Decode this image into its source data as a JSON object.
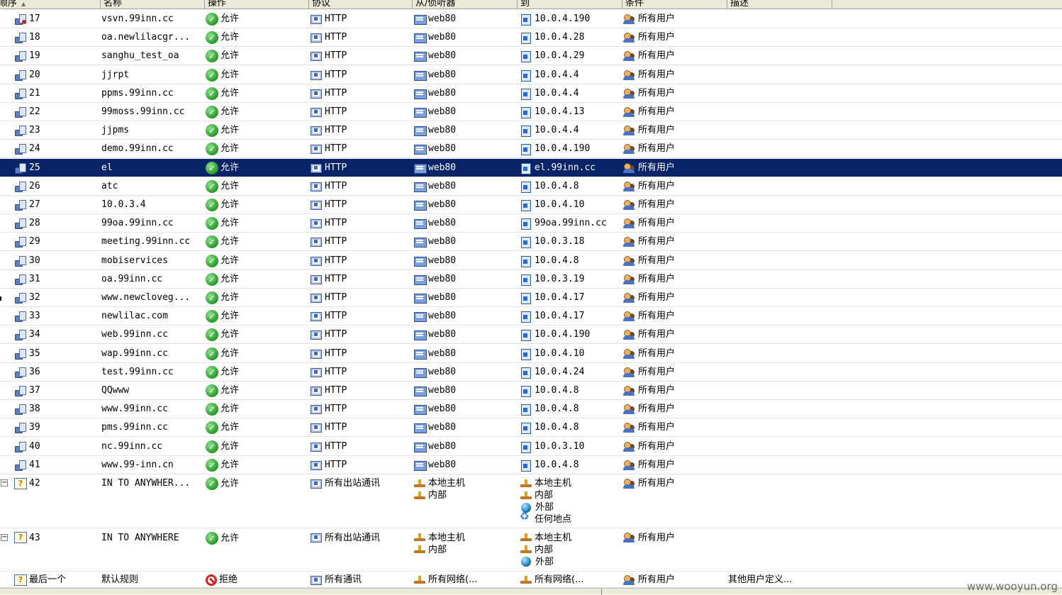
{
  "columns": {
    "order": "顺序",
    "name": "名称",
    "action": "操作",
    "protocol": "协议",
    "from": "从/侦听器",
    "to": "到",
    "condition": "条件",
    "desc": "描述"
  },
  "rules": [
    {
      "order": "17",
      "name": "vsvn.99inn.cc",
      "action": "允许",
      "protocol": "HTTP",
      "from": "web80",
      "to": "10.0.4.190",
      "condition": "所有用户",
      "locked": true
    },
    {
      "order": "18",
      "name": "oa.newlilacgr...",
      "action": "允许",
      "protocol": "HTTP",
      "from": "web80",
      "to": "10.0.4.28",
      "condition": "所有用户"
    },
    {
      "order": "19",
      "name": "sanghu_test_oa",
      "action": "允许",
      "protocol": "HTTP",
      "from": "web80",
      "to": "10.0.4.29",
      "condition": "所有用户"
    },
    {
      "order": "20",
      "name": "jjrpt",
      "action": "允许",
      "protocol": "HTTP",
      "from": "web80",
      "to": "10.0.4.4",
      "condition": "所有用户"
    },
    {
      "order": "21",
      "name": "ppms.99inn.cc",
      "action": "允许",
      "protocol": "HTTP",
      "from": "web80",
      "to": "10.0.4.4",
      "condition": "所有用户"
    },
    {
      "order": "22",
      "name": "99moss.99inn.cc",
      "action": "允许",
      "protocol": "HTTP",
      "from": "web80",
      "to": "10.0.4.13",
      "condition": "所有用户"
    },
    {
      "order": "23",
      "name": "jjpms",
      "action": "允许",
      "protocol": "HTTP",
      "from": "web80",
      "to": "10.0.4.4",
      "condition": "所有用户"
    },
    {
      "order": "24",
      "name": "demo.99inn.cc",
      "action": "允许",
      "protocol": "HTTP",
      "from": "web80",
      "to": "10.0.4.190",
      "condition": "所有用户"
    },
    {
      "order": "25",
      "name": "el",
      "action": "允许",
      "protocol": "HTTP",
      "from": "web80",
      "to": "el.99inn.cc",
      "condition": "所有用户",
      "selected": true
    },
    {
      "order": "26",
      "name": "atc",
      "action": "允许",
      "protocol": "HTTP",
      "from": "web80",
      "to": "10.0.4.8",
      "condition": "所有用户"
    },
    {
      "order": "27",
      "name": "10.0.3.4",
      "action": "允许",
      "protocol": "HTTP",
      "from": "web80",
      "to": "10.0.4.10",
      "condition": "所有用户"
    },
    {
      "order": "28",
      "name": "99oa.99inn.cc",
      "action": "允许",
      "protocol": "HTTP",
      "from": "web80",
      "to": "99oa.99inn.cc",
      "condition": "所有用户"
    },
    {
      "order": "29",
      "name": "meeting.99inn.cc",
      "action": "允许",
      "protocol": "HTTP",
      "from": "web80",
      "to": "10.0.3.18",
      "condition": "所有用户"
    },
    {
      "order": "30",
      "name": "mobiservices",
      "action": "允许",
      "protocol": "HTTP",
      "from": "web80",
      "to": "10.0.4.8",
      "condition": "所有用户"
    },
    {
      "order": "31",
      "name": "oa.99inn.cc",
      "action": "允许",
      "protocol": "HTTP",
      "from": "web80",
      "to": "10.0.3.19",
      "condition": "所有用户"
    },
    {
      "order": "32",
      "name": "www.newcloveg...",
      "action": "允许",
      "protocol": "HTTP",
      "from": "web80",
      "to": "10.0.4.17",
      "condition": "所有用户"
    },
    {
      "order": "33",
      "name": "newlilac.com",
      "action": "允许",
      "protocol": "HTTP",
      "from": "web80",
      "to": "10.0.4.17",
      "condition": "所有用户"
    },
    {
      "order": "34",
      "name": "web.99inn.cc",
      "action": "允许",
      "protocol": "HTTP",
      "from": "web80",
      "to": "10.0.4.190",
      "condition": "所有用户"
    },
    {
      "order": "35",
      "name": "wap.99inn.cc",
      "action": "允许",
      "protocol": "HTTP",
      "from": "web80",
      "to": "10.0.4.10",
      "condition": "所有用户"
    },
    {
      "order": "36",
      "name": "test.99inn.cc",
      "action": "允许",
      "protocol": "HTTP",
      "from": "web80",
      "to": "10.0.4.24",
      "condition": "所有用户"
    },
    {
      "order": "37",
      "name": "QQwww",
      "action": "允许",
      "protocol": "HTTP",
      "from": "web80",
      "to": "10.0.4.8",
      "condition": "所有用户"
    },
    {
      "order": "38",
      "name": "www.99inn.cc",
      "action": "允许",
      "protocol": "HTTP",
      "from": "web80",
      "to": "10.0.4.8",
      "condition": "所有用户"
    },
    {
      "order": "39",
      "name": "pms.99inn.cc",
      "action": "允许",
      "protocol": "HTTP",
      "from": "web80",
      "to": "10.0.4.8",
      "condition": "所有用户"
    },
    {
      "order": "40",
      "name": "nc.99inn.cc",
      "action": "允许",
      "protocol": "HTTP",
      "from": "web80",
      "to": "10.0.3.10",
      "condition": "所有用户"
    },
    {
      "order": "41",
      "name": "www.99-inn.cn",
      "action": "允许",
      "protocol": "HTTP",
      "from": "web80",
      "to": "10.0.4.8",
      "condition": "所有用户"
    }
  ],
  "group_rules": [
    {
      "order": "42",
      "name": "IN TO ANYWHER...",
      "action": "允许",
      "protocol": "所有出站通讯",
      "from": [
        "本地主机",
        "内部"
      ],
      "to": [
        "本地主机",
        "内部",
        "外部",
        "任何地点"
      ],
      "condition": "所有用户"
    },
    {
      "order": "43",
      "name": "IN TO ANYWHERE",
      "action": "允许",
      "protocol": "所有出站通讯",
      "from": [
        "本地主机",
        "内部"
      ],
      "to": [
        "本地主机",
        "内部",
        "外部"
      ],
      "condition": "所有用户"
    }
  ],
  "last_rule": {
    "order": "最后一个",
    "name": "默认规则",
    "action": "拒绝",
    "protocol": "所有通讯",
    "from": "所有网络(...",
    "to": "所有网络(...",
    "condition": "所有用户",
    "desc": "其他用户定义..."
  },
  "watermark": "www.wooyun.org",
  "colors": {
    "selected_bg": "#0a246a",
    "allow": "#239b23",
    "deny": "#d42020"
  }
}
